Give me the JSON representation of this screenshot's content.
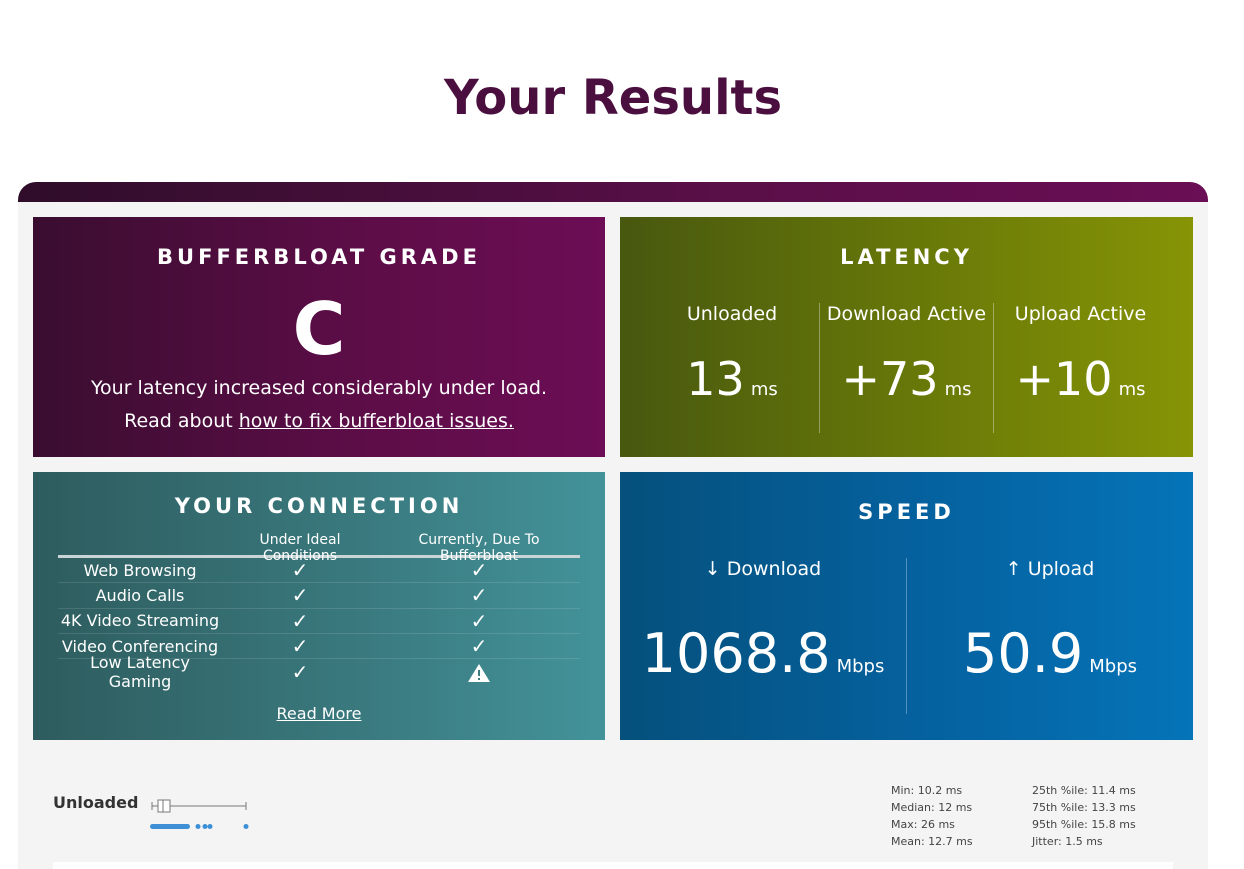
{
  "page_title": "Your Results",
  "grade_card": {
    "title": "BUFFERBLOAT GRADE",
    "grade": "C",
    "description": "Your latency increased considerably under load.",
    "read_prefix": "Read about ",
    "read_link": "how to fix bufferbloat issues."
  },
  "latency_card": {
    "title": "LATENCY",
    "columns": [
      {
        "label": "Unloaded",
        "value": "13",
        "unit": "ms"
      },
      {
        "label": "Download Active",
        "value": "+73",
        "unit": "ms"
      },
      {
        "label": "Upload Active",
        "value": "+10",
        "unit": "ms"
      }
    ]
  },
  "connection_card": {
    "title": "YOUR CONNECTION",
    "headers": [
      "",
      "Under Ideal Conditions",
      "Currently, Due To Bufferbloat"
    ],
    "rows": [
      {
        "name": "Web Browsing",
        "ideal": "✓",
        "current": "✓"
      },
      {
        "name": "Audio Calls",
        "ideal": "✓",
        "current": "✓"
      },
      {
        "name": "4K Video Streaming",
        "ideal": "✓",
        "current": "✓"
      },
      {
        "name": "Video Conferencing",
        "ideal": "✓",
        "current": "✓"
      },
      {
        "name": "Low Latency Gaming",
        "ideal": "✓",
        "current": "warning"
      }
    ],
    "read_more": "Read More"
  },
  "speed_card": {
    "title": "SPEED",
    "download": {
      "arrow": "↓",
      "label": "Download",
      "value": "1068.8",
      "unit": "Mbps"
    },
    "upload": {
      "arrow": "↑",
      "label": "Upload",
      "value": "50.9",
      "unit": "Mbps"
    }
  },
  "unloaded_stats": {
    "label": "Unloaded",
    "left": [
      "Min: 10.2 ms",
      "Median: 12 ms",
      "Max: 26 ms",
      "Mean: 12.7 ms"
    ],
    "right": [
      "25th %ile: 11.4 ms",
      "75th %ile: 13.3 ms",
      "95th %ile: 15.8 ms",
      "Jitter: 1.5 ms"
    ]
  },
  "colors": {
    "title": "#4a0f3e",
    "grade_bg": "#5e0d48",
    "latency_bg": "#6a7a08",
    "connection_bg": "#3a7b80",
    "speed_bg": "#0562a0",
    "boxplot_dots": "#3d8fd6"
  }
}
